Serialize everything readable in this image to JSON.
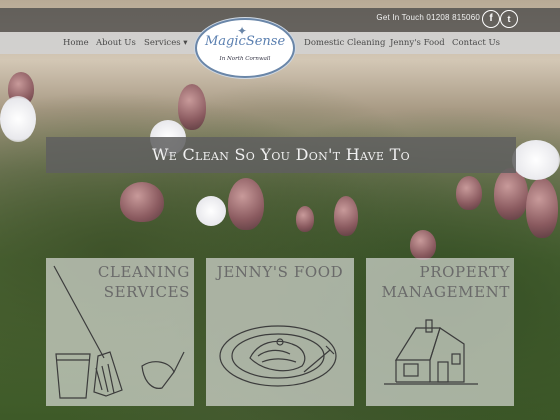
{
  "topbar": {
    "contact_text": "Get In Touch 01208 815060",
    "social": [
      {
        "icon": "facebook-icon",
        "glyph": "f"
      },
      {
        "icon": "twitter-icon",
        "glyph": "t"
      }
    ]
  },
  "nav": {
    "left": [
      "Home",
      "About Us",
      "Services ▾"
    ],
    "right": [
      "Domestic Cleaning",
      "Jenny's Food",
      "Contact Us"
    ]
  },
  "logo": {
    "brand": "MagicSense",
    "sub": "In North Cornwall"
  },
  "hero": {
    "tagline": "We Clean So You Don't Have To"
  },
  "cards": [
    {
      "title_line1": "CLEANING",
      "title_line2": "SERVICES",
      "icon": "mop-bucket-icon"
    },
    {
      "title_line1": "JENNY'S FOOD",
      "title_line2": "",
      "icon": "food-plate-icon"
    },
    {
      "title_line1": "PROPERTY",
      "title_line2": "MANAGEMENT",
      "icon": "house-icon"
    }
  ],
  "colors": {
    "topbar": "#464646",
    "navbar": "#d2d2d2",
    "tagline_box": "#5f5f5f",
    "card_bg": "#ebebeb",
    "logo_blue": "#5a7fb0"
  }
}
